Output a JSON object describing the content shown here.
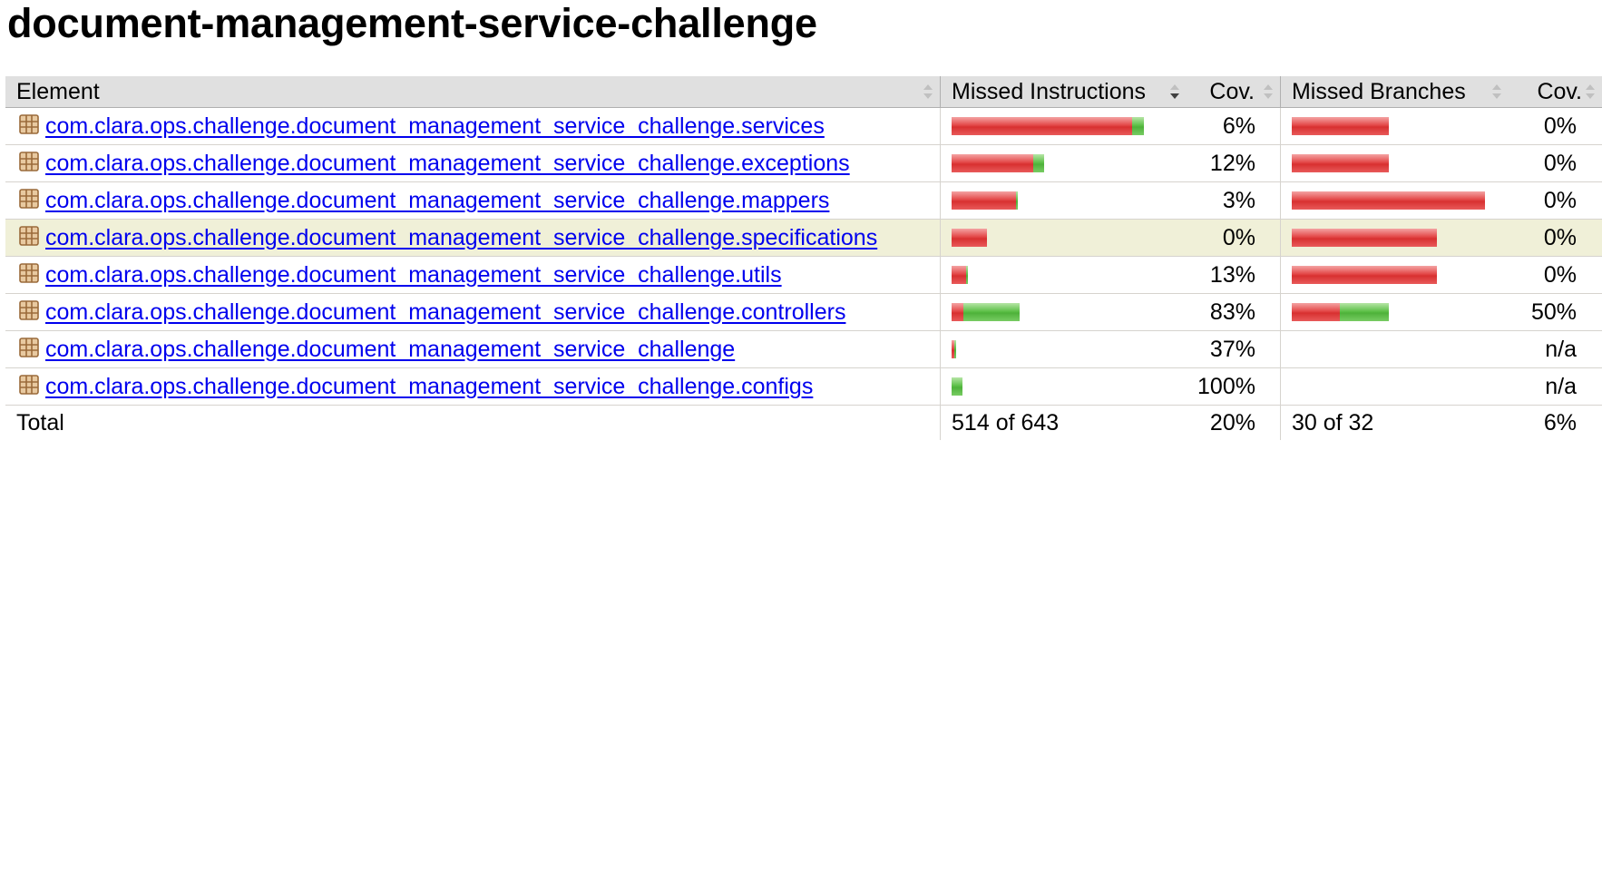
{
  "page": {
    "title": "document-management-service-challenge"
  },
  "table": {
    "headers": {
      "element": "Element",
      "missed_instructions": "Missed Instructions",
      "cov_instructions": "Cov.",
      "missed_branches": "Missed Branches",
      "cov_branches": "Cov."
    },
    "rows": [
      {
        "name": "com.clara.ops.challenge.document_management_service_challenge.services",
        "instr_missed_frac": 0.94,
        "instr_scale": 1.0,
        "instr_cov": "6%",
        "branch_missed_frac": 1.0,
        "branch_scale": 0.5,
        "branch_cov": "0%",
        "has_branches": true
      },
      {
        "name": "com.clara.ops.challenge.document_management_service_challenge.exceptions",
        "instr_missed_frac": 0.88,
        "instr_scale": 0.48,
        "instr_cov": "12%",
        "branch_missed_frac": 1.0,
        "branch_scale": 0.5,
        "branch_cov": "0%",
        "has_branches": true
      },
      {
        "name": "com.clara.ops.challenge.document_management_service_challenge.mappers",
        "instr_missed_frac": 0.97,
        "instr_scale": 0.345,
        "instr_cov": "3%",
        "branch_missed_frac": 1.0,
        "branch_scale": 1.0,
        "branch_cov": "0%",
        "has_branches": true
      },
      {
        "name": "com.clara.ops.challenge.document_management_service_challenge.specifications",
        "instr_missed_frac": 1.0,
        "instr_scale": 0.185,
        "instr_cov": "0%",
        "branch_missed_frac": 1.0,
        "branch_scale": 0.75,
        "branch_cov": "0%",
        "has_branches": true
      },
      {
        "name": "com.clara.ops.challenge.document_management_service_challenge.utils",
        "instr_missed_frac": 0.87,
        "instr_scale": 0.085,
        "instr_cov": "13%",
        "branch_missed_frac": 1.0,
        "branch_scale": 0.75,
        "branch_cov": "0%",
        "has_branches": true
      },
      {
        "name": "com.clara.ops.challenge.document_management_service_challenge.controllers",
        "instr_missed_frac": 0.17,
        "instr_scale": 0.355,
        "instr_cov": "83%",
        "branch_missed_frac": 0.5,
        "branch_scale": 0.5,
        "branch_cov": "50%",
        "has_branches": true
      },
      {
        "name": "com.clara.ops.challenge.document_management_service_challenge",
        "instr_missed_frac": 0.63,
        "instr_scale": 0.025,
        "instr_cov": "37%",
        "branch_missed_frac": 0,
        "branch_scale": 0,
        "branch_cov": "n/a",
        "has_branches": false
      },
      {
        "name": "com.clara.ops.challenge.document_management_service_challenge.configs",
        "instr_missed_frac": 0.0,
        "instr_scale": 0.055,
        "instr_cov": "100%",
        "branch_missed_frac": 0,
        "branch_scale": 0,
        "branch_cov": "n/a",
        "has_branches": false
      }
    ],
    "highlighted_row": 3,
    "total": {
      "label": "Total",
      "missed_instructions": "514 of 643",
      "cov_instructions": "20%",
      "missed_branches": "30 of 32",
      "cov_branches": "6%"
    }
  },
  "colors": {
    "missed": "#e34848",
    "covered": "#5fc14a",
    "header_bg": "#e0e0e0",
    "highlight_bg": "#f0f0d8",
    "link": "#0000ee"
  },
  "icons": {
    "package": "package-icon",
    "sort": "sort-icon",
    "sort_active": "sort-desc-icon"
  }
}
